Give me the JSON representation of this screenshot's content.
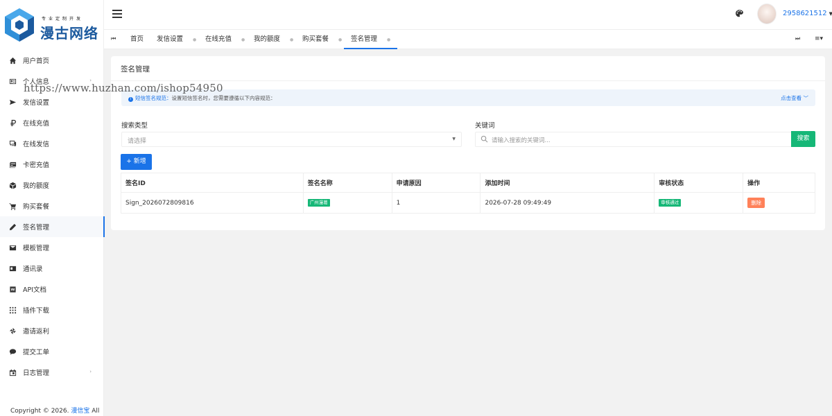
{
  "logo": {
    "slogan": "专业定制开发",
    "name": "漫古网络",
    "colors": {
      "primary": "#1c5a9e",
      "secondary": "#2f8fd8"
    }
  },
  "sidebar": {
    "items": [
      {
        "label": "用户首页",
        "icon": "home-icon",
        "has_arrow": false
      },
      {
        "label": "个人信息",
        "icon": "id-card-icon",
        "has_arrow": true
      },
      {
        "label": "发信设置",
        "icon": "send-icon",
        "has_arrow": false
      },
      {
        "label": "在线充值",
        "icon": "currency-icon",
        "has_arrow": false
      },
      {
        "label": "在线发信",
        "icon": "chat-icon",
        "has_arrow": false
      },
      {
        "label": "卡密充值",
        "icon": "card-icon",
        "has_arrow": false
      },
      {
        "label": "我的额度",
        "icon": "cube-icon",
        "has_arrow": false
      },
      {
        "label": "购买套餐",
        "icon": "cart-icon",
        "has_arrow": false
      },
      {
        "label": "签名管理",
        "icon": "pen-icon",
        "has_arrow": false,
        "active": true
      },
      {
        "label": "模板管理",
        "icon": "mail-template-icon",
        "has_arrow": false
      },
      {
        "label": "通讯录",
        "icon": "contacts-icon",
        "has_arrow": false
      },
      {
        "label": "API文档",
        "icon": "doc-w-icon",
        "has_arrow": false
      },
      {
        "label": "插件下载",
        "icon": "grid-icon",
        "has_arrow": false
      },
      {
        "label": "邀请返利",
        "icon": "pinwheel-icon",
        "has_arrow": false
      },
      {
        "label": "提交工单",
        "icon": "comment-icon",
        "has_arrow": false
      },
      {
        "label": "日志管理",
        "icon": "calendar-icon",
        "has_arrow": true
      }
    ]
  },
  "copyright": {
    "prefix": "Copyright © 2026.",
    "brand": "漫信宝",
    "suffix": "All"
  },
  "header": {
    "username": "2958621512",
    "colors": {
      "link": "#1a73e8"
    }
  },
  "tabs": [
    {
      "label": "首页",
      "closable": false
    },
    {
      "label": "发信设置",
      "closable": true
    },
    {
      "label": "在线充值",
      "closable": true
    },
    {
      "label": "我的额度",
      "closable": true
    },
    {
      "label": "购买套餐",
      "closable": true
    },
    {
      "label": "签名管理",
      "closable": true,
      "active": true
    }
  ],
  "card": {
    "title": "签名管理",
    "notice": {
      "label": "短信签名规范：",
      "text": "设置短信签名时，您需要遵循以下内容规范：",
      "link": "点击查看"
    },
    "search_type": {
      "label": "搜索类型",
      "placeholder": "请选择"
    },
    "keyword": {
      "label": "关键词",
      "placeholder": "请输入搜索的关键词..."
    },
    "search_button": "搜索",
    "add_button": "+ 新增"
  },
  "table": {
    "columns": [
      "签名ID",
      "签名名称",
      "申请原因",
      "添加时间",
      "审核状态",
      "操作"
    ],
    "rows": [
      {
        "id": "Sign_2026072809816",
        "name": "广州漫葛",
        "reason": "1",
        "time": "2026-07-28 09:49:49",
        "status": "审核通过",
        "action": "删除"
      }
    ]
  },
  "watermark": "https://www.huzhan.com/ishop54950",
  "colors": {
    "primary": "#1a73e8",
    "success": "#16b777",
    "danger": "#ff5722",
    "background": "#f2f2f2"
  }
}
